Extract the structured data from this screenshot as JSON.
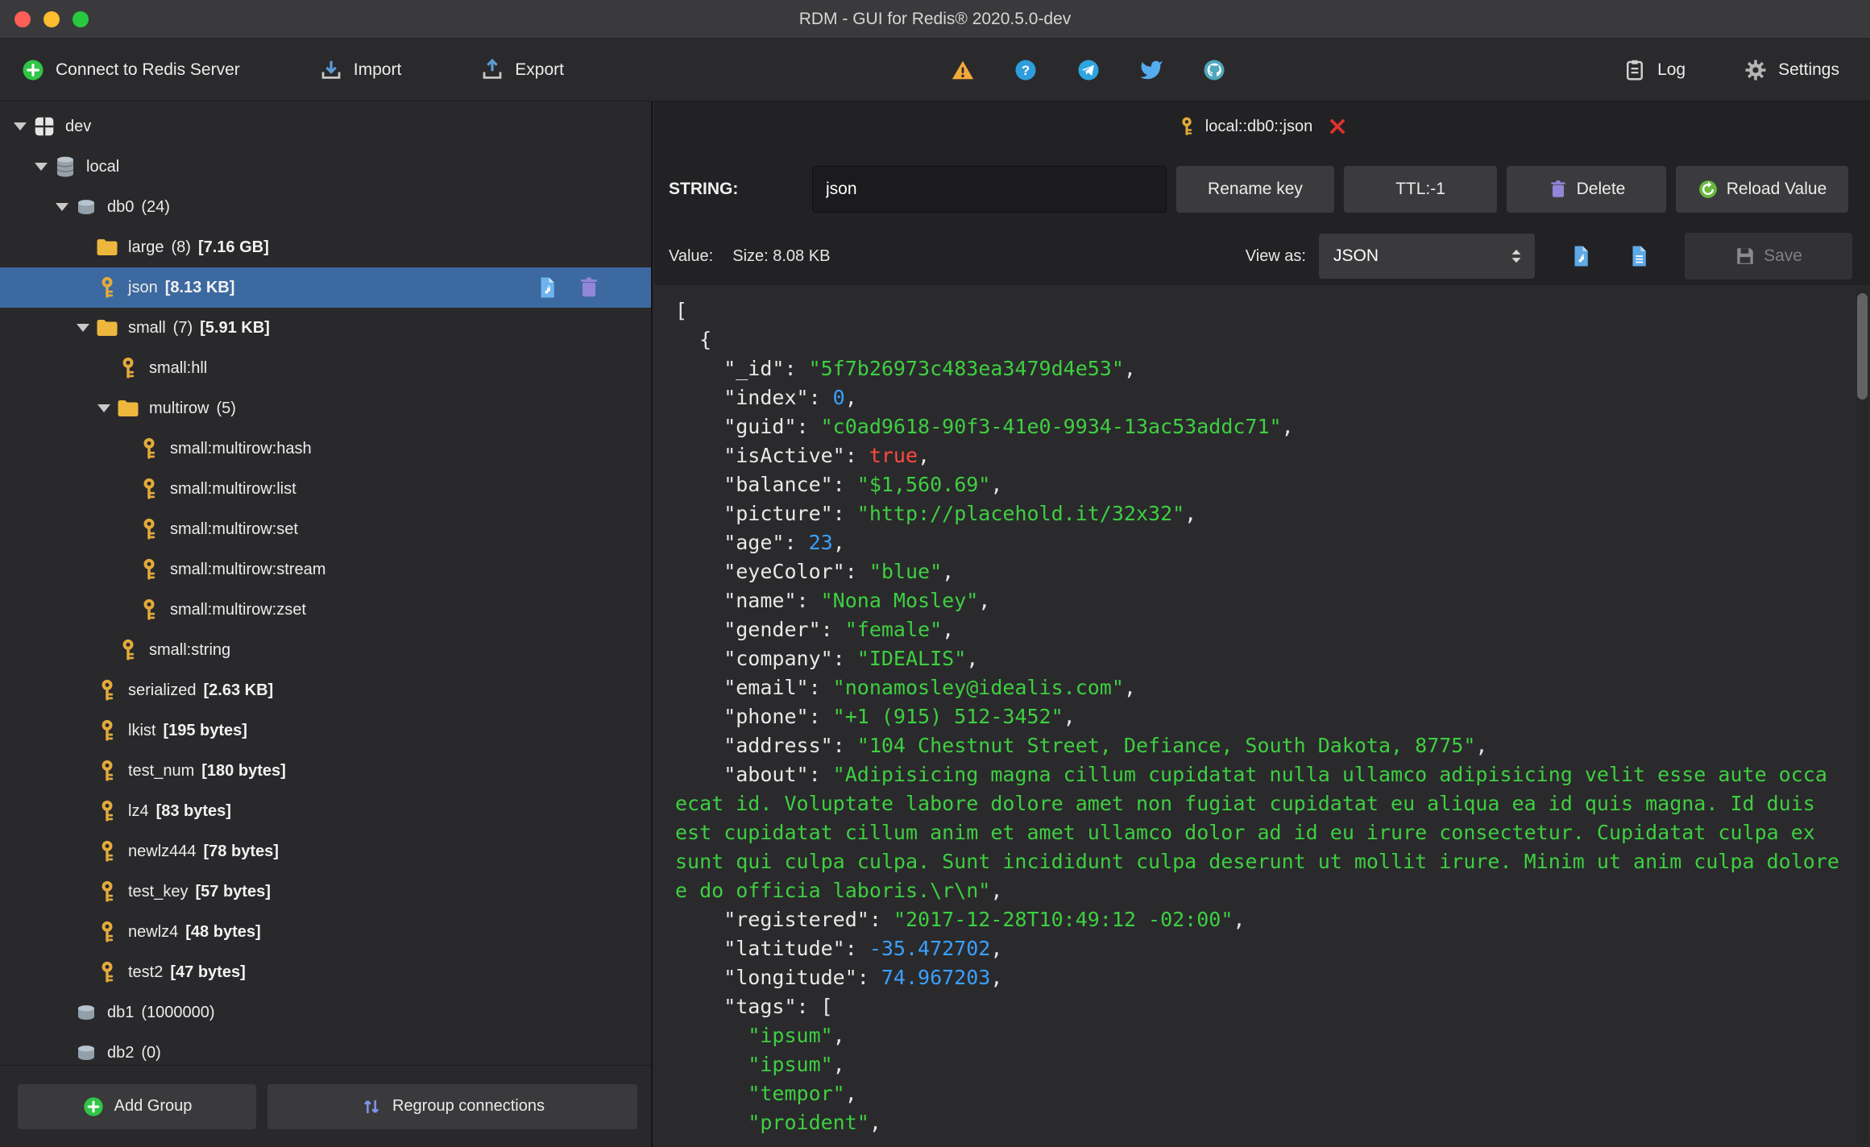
{
  "window": {
    "title": "RDM - GUI for Redis® 2020.5.0-dev"
  },
  "colors": {
    "accent_selected": "#3c69a0",
    "string_green": "#3ecf41",
    "number_blue": "#3ba0ff",
    "bool_red": "#ff4a3d",
    "key_gold": "#e3aa3c"
  },
  "toolbar": {
    "connect_label": "Connect to Redis Server",
    "import_label": "Import",
    "export_label": "Export",
    "log_label": "Log",
    "settings_label": "Settings"
  },
  "sidebar": {
    "add_group_label": "Add Group",
    "regroup_label": "Regroup connections",
    "tree": [
      {
        "level": 0,
        "arrow": true,
        "icon": "server",
        "label": "dev"
      },
      {
        "level": 1,
        "arrow": true,
        "icon": "dbstack",
        "label": "local"
      },
      {
        "level": 2,
        "arrow": true,
        "icon": "db",
        "label": "db0",
        "count": "(24)"
      },
      {
        "level": 3,
        "arrow": false,
        "icon": "folder",
        "label": "large",
        "count": "(8)",
        "size": "[7.16 GB]"
      },
      {
        "level": 3,
        "arrow": false,
        "icon": "key",
        "label": "json",
        "size": "[8.13 KB]",
        "selected": true,
        "actions": true
      },
      {
        "level": 3,
        "arrow": true,
        "icon": "folder",
        "label": "small",
        "count": "(7)",
        "size": "[5.91 KB]"
      },
      {
        "level": 4,
        "arrow": false,
        "icon": "key",
        "label": "small:hll"
      },
      {
        "level": 4,
        "arrow": true,
        "icon": "folder",
        "label": "multirow",
        "count": "(5)"
      },
      {
        "level": 5,
        "arrow": false,
        "icon": "key",
        "label": "small:multirow:hash"
      },
      {
        "level": 5,
        "arrow": false,
        "icon": "key",
        "label": "small:multirow:list"
      },
      {
        "level": 5,
        "arrow": false,
        "icon": "key",
        "label": "small:multirow:set"
      },
      {
        "level": 5,
        "arrow": false,
        "icon": "key",
        "label": "small:multirow:stream"
      },
      {
        "level": 5,
        "arrow": false,
        "icon": "key",
        "label": "small:multirow:zset"
      },
      {
        "level": 4,
        "arrow": false,
        "icon": "key",
        "label": "small:string"
      },
      {
        "level": 3,
        "arrow": false,
        "icon": "key",
        "label": "serialized",
        "size": "[2.63 KB]"
      },
      {
        "level": 3,
        "arrow": false,
        "icon": "key",
        "label": "lkist",
        "size": "[195 bytes]"
      },
      {
        "level": 3,
        "arrow": false,
        "icon": "key",
        "label": "test_num",
        "size": "[180 bytes]"
      },
      {
        "level": 3,
        "arrow": false,
        "icon": "key",
        "label": "lz4",
        "size": "[83 bytes]"
      },
      {
        "level": 3,
        "arrow": false,
        "icon": "key",
        "label": "newlz444",
        "size": "[78 bytes]"
      },
      {
        "level": 3,
        "arrow": false,
        "icon": "key",
        "label": "test_key",
        "size": "[57 bytes]"
      },
      {
        "level": 3,
        "arrow": false,
        "icon": "key",
        "label": "newlz4",
        "size": "[48 bytes]"
      },
      {
        "level": 3,
        "arrow": false,
        "icon": "key",
        "label": "test2",
        "size": "[47 bytes]"
      },
      {
        "level": 2,
        "arrow": false,
        "icon": "db",
        "label": "db1",
        "count": "(1000000)"
      },
      {
        "level": 2,
        "arrow": false,
        "icon": "db",
        "label": "db2",
        "count": "(0)"
      }
    ]
  },
  "main": {
    "tab_label": "local::db0::json",
    "editor": {
      "type_label": "STRING:",
      "key_name": "json",
      "rename_label": "Rename key",
      "ttl_label": "TTL:-1",
      "delete_label": "Delete",
      "reload_label": "Reload Value"
    },
    "value_bar": {
      "value_label": "Value:",
      "size_text": "Size: 8.08 KB",
      "view_as_label": "View as:",
      "view_mode": "JSON",
      "save_label": "Save"
    },
    "viewer": {
      "lines": [
        [
          [
            "[",
            ""
          ]
        ],
        [
          [
            "  {",
            ""
          ]
        ],
        [
          [
            "    \"_id\": ",
            ""
          ],
          [
            "\"5f7b26973c483ea3479d4e53\"",
            "s"
          ],
          [
            ",",
            ""
          ]
        ],
        [
          [
            "    \"index\": ",
            ""
          ],
          [
            "0",
            "n"
          ],
          [
            ",",
            ""
          ]
        ],
        [
          [
            "    \"guid\": ",
            ""
          ],
          [
            "\"c0ad9618-90f3-41e0-9934-13ac53addc71\"",
            "s"
          ],
          [
            ",",
            ""
          ]
        ],
        [
          [
            "    \"isActive\": ",
            ""
          ],
          [
            "true",
            "b"
          ],
          [
            ",",
            ""
          ]
        ],
        [
          [
            "    \"balance\": ",
            ""
          ],
          [
            "\"$1,560.69\"",
            "s"
          ],
          [
            ",",
            ""
          ]
        ],
        [
          [
            "    \"picture\": ",
            ""
          ],
          [
            "\"http://placehold.it/32x32\"",
            "s"
          ],
          [
            ",",
            ""
          ]
        ],
        [
          [
            "    \"age\": ",
            ""
          ],
          [
            "23",
            "n"
          ],
          [
            ",",
            ""
          ]
        ],
        [
          [
            "    \"eyeColor\": ",
            ""
          ],
          [
            "\"blue\"",
            "s"
          ],
          [
            ",",
            ""
          ]
        ],
        [
          [
            "    \"name\": ",
            ""
          ],
          [
            "\"Nona Mosley\"",
            "s"
          ],
          [
            ",",
            ""
          ]
        ],
        [
          [
            "    \"gender\": ",
            ""
          ],
          [
            "\"female\"",
            "s"
          ],
          [
            ",",
            ""
          ]
        ],
        [
          [
            "    \"company\": ",
            ""
          ],
          [
            "\"IDEALIS\"",
            "s"
          ],
          [
            ",",
            ""
          ]
        ],
        [
          [
            "    \"email\": ",
            ""
          ],
          [
            "\"nonamosley@idealis.com\"",
            "s"
          ],
          [
            ",",
            ""
          ]
        ],
        [
          [
            "    \"phone\": ",
            ""
          ],
          [
            "\"+1 (915) 512-3452\"",
            "s"
          ],
          [
            ",",
            ""
          ]
        ],
        [
          [
            "    \"address\": ",
            ""
          ],
          [
            "\"104 Chestnut Street, Defiance, South Dakota, 8775\"",
            "s"
          ],
          [
            ",",
            ""
          ]
        ],
        [
          [
            "    \"about\": ",
            ""
          ],
          [
            "\"Adipisicing magna cillum cupidatat nulla ullamco adipisicing velit esse aute occa",
            "s"
          ]
        ],
        [
          [
            "ecat id. Voluptate labore dolore amet non fugiat cupidatat eu aliqua ea id quis magna. Id duis",
            "s"
          ]
        ],
        [
          [
            "est cupidatat cillum anim et amet ullamco dolor ad id eu irure consectetur. Cupidatat culpa ex",
            "s"
          ]
        ],
        [
          [
            "sunt qui culpa culpa. Sunt incididunt culpa deserunt ut mollit irure. Minim ut anim culpa dolore",
            "s"
          ]
        ],
        [
          [
            "e do officia laboris.\\r\\n\"",
            "s"
          ],
          [
            ",",
            ""
          ]
        ],
        [
          [
            "    \"registered\": ",
            ""
          ],
          [
            "\"2017-12-28T10:49:12 -02:00\"",
            "s"
          ],
          [
            ",",
            ""
          ]
        ],
        [
          [
            "    \"latitude\": ",
            ""
          ],
          [
            "-35.472702",
            "n"
          ],
          [
            ",",
            ""
          ]
        ],
        [
          [
            "    \"longitude\": ",
            ""
          ],
          [
            "74.967203",
            "n"
          ],
          [
            ",",
            ""
          ]
        ],
        [
          [
            "    \"tags\": [",
            ""
          ]
        ],
        [
          [
            "      ",
            ""
          ],
          [
            "\"ipsum\"",
            "s"
          ],
          [
            ",",
            ""
          ]
        ],
        [
          [
            "      ",
            ""
          ],
          [
            "\"ipsum\"",
            "s"
          ],
          [
            ",",
            ""
          ]
        ],
        [
          [
            "      ",
            ""
          ],
          [
            "\"tempor\"",
            "s"
          ],
          [
            ",",
            ""
          ]
        ],
        [
          [
            "      ",
            ""
          ],
          [
            "\"proident\"",
            "s"
          ],
          [
            ",",
            ""
          ]
        ]
      ]
    }
  }
}
